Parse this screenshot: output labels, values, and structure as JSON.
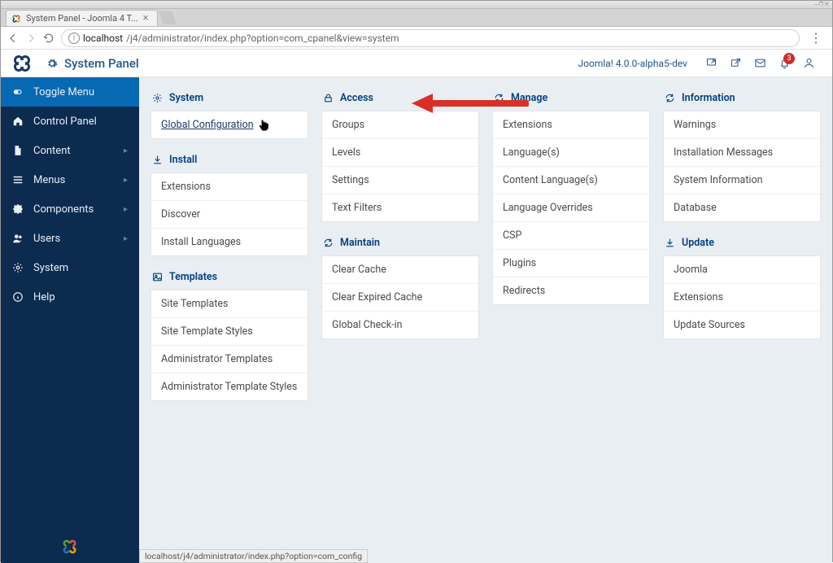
{
  "os": {
    "buttons": "⎯ ❐ ✕"
  },
  "tab": {
    "title": "System Panel - Joomla 4 T..."
  },
  "url": {
    "host": "localhost",
    "path": "/j4/administrator/index.php?option=com_cpanel&view=system"
  },
  "header": {
    "title": "System Panel",
    "version": "Joomla! 4.0.0-alpha5-dev",
    "notif_count": "3"
  },
  "sidebar": {
    "items": [
      {
        "label": "Toggle Menu",
        "icon": "toggle",
        "chev": false,
        "active": true
      },
      {
        "label": "Control Panel",
        "icon": "home",
        "chev": false
      },
      {
        "label": "Content",
        "icon": "file",
        "chev": true
      },
      {
        "label": "Menus",
        "icon": "menu",
        "chev": true
      },
      {
        "label": "Components",
        "icon": "puzzle",
        "chev": true
      },
      {
        "label": "Users",
        "icon": "users",
        "chev": true
      },
      {
        "label": "System",
        "icon": "gear",
        "chev": false
      },
      {
        "label": "Help",
        "icon": "info",
        "chev": false
      }
    ]
  },
  "panel": {
    "cols": [
      {
        "blocks": [
          {
            "icon": "gear",
            "title": "System",
            "rows": [
              "Global Configuration"
            ],
            "hover_row": 0
          },
          {
            "icon": "download",
            "title": "Install",
            "rows": [
              "Extensions",
              "Discover",
              "Install Languages"
            ]
          },
          {
            "icon": "image",
            "title": "Templates",
            "rows": [
              "Site Templates",
              "Site Template Styles",
              "Administrator Templates",
              "Administrator Template Styles"
            ]
          }
        ]
      },
      {
        "blocks": [
          {
            "icon": "lock",
            "title": "Access",
            "rows": [
              "Groups",
              "Levels",
              "Settings",
              "Text Filters"
            ]
          },
          {
            "icon": "refresh",
            "title": "Maintain",
            "rows": [
              "Clear Cache",
              "Clear Expired Cache",
              "Global Check-in"
            ]
          }
        ]
      },
      {
        "blocks": [
          {
            "icon": "refresh",
            "title": "Manage",
            "rows": [
              "Extensions",
              "Language(s)",
              "Content Language(s)",
              "Language Overrides",
              "CSP",
              "Plugins",
              "Redirects"
            ]
          }
        ]
      },
      {
        "blocks": [
          {
            "icon": "refresh",
            "title": "Information",
            "rows": [
              "Warnings",
              "Installation Messages",
              "System Information",
              "Database"
            ]
          },
          {
            "icon": "download",
            "title": "Update",
            "rows": [
              "Joomla",
              "Extensions",
              "Update Sources"
            ]
          }
        ]
      }
    ]
  },
  "status_bar": "localhost/j4/administrator/index.php?option=com_config"
}
